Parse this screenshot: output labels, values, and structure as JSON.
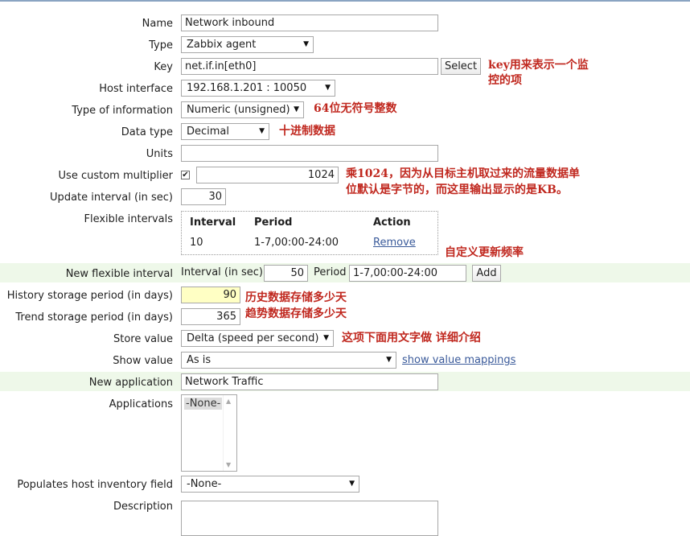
{
  "form": {
    "name": {
      "label": "Name",
      "value": "Network inbound"
    },
    "type": {
      "label": "Type",
      "value": "Zabbix agent"
    },
    "key": {
      "label": "Key",
      "value": "net.if.in[eth0]",
      "button": "Select"
    },
    "host_interface": {
      "label": "Host interface",
      "value": "192.168.1.201 : 10050"
    },
    "type_of_information": {
      "label": "Type of information",
      "value": "Numeric (unsigned)"
    },
    "data_type": {
      "label": "Data type",
      "value": "Decimal"
    },
    "units": {
      "label": "Units",
      "value": ""
    },
    "custom_multiplier": {
      "label": "Use custom multiplier",
      "checked": true,
      "value": "1024"
    },
    "update_interval": {
      "label": "Update interval (in sec)",
      "value": "30"
    },
    "flexible_intervals": {
      "label": "Flexible intervals",
      "headers": {
        "interval": "Interval",
        "period": "Period",
        "action": "Action"
      },
      "rows": [
        {
          "interval": "10",
          "period": "1-7,00:00-24:00",
          "action": "Remove"
        }
      ]
    },
    "new_flexible_interval": {
      "label": "New flexible interval",
      "interval_label": "Interval (in sec)",
      "interval_value": "50",
      "period_label": "Period",
      "period_value": "1-7,00:00-24:00",
      "add_button": "Add"
    },
    "history": {
      "label": "History storage period (in days)",
      "value": "90"
    },
    "trend": {
      "label": "Trend storage period (in days)",
      "value": "365"
    },
    "store_value": {
      "label": "Store value",
      "value": "Delta (speed per second)"
    },
    "show_value": {
      "label": "Show value",
      "value": "As is",
      "link": "show value mappings"
    },
    "new_application": {
      "label": "New application",
      "value": "Network Traffic"
    },
    "applications": {
      "label": "Applications",
      "options": [
        "-None-"
      ]
    },
    "inventory_field": {
      "label": "Populates host inventory field",
      "value": "-None-"
    },
    "description": {
      "label": "Description",
      "value": ""
    }
  },
  "annotations": {
    "key_note_line1": "key用来表示一个监",
    "key_note_line2": "控的项",
    "type_info_note": "64位无符号整数",
    "data_type_note": "十进制数据",
    "multiplier_note_line1": "乘1024，因为从目标主机取过来的流量数据单",
    "multiplier_note_line2": "位默认是字节的，而这里输出显示的是KB。",
    "flex_note": "自定义更新频率",
    "history_note": "历史数据存储多少天",
    "trend_note": "趋势数据存储多少天",
    "store_note": "这项下面用文字做 详细介绍"
  },
  "colors": {
    "annotation": "#c0281f",
    "link": "#3a5a9a",
    "highlight_band": "#eef8e9",
    "history_field": "#ffffc4"
  }
}
